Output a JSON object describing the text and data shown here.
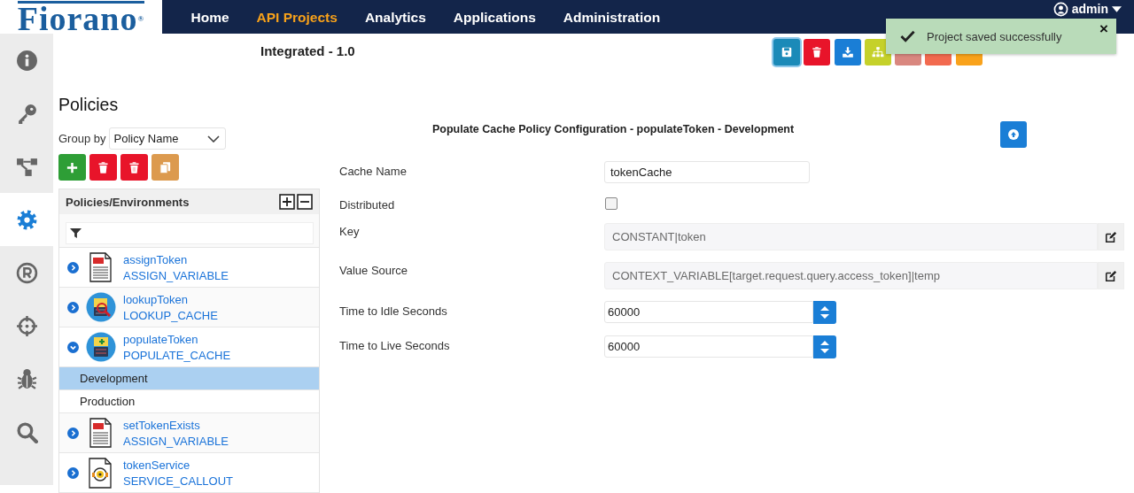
{
  "logo": "Fiorano$^{®}$",
  "nav": [
    {
      "label": "Home",
      "selected": false
    },
    {
      "label": "API Projects",
      "selected": true
    },
    {
      "label": "Analytics",
      "selected": false
    },
    {
      "label": "Applications",
      "selected": false
    },
    {
      "label": "Administration",
      "selected": false
    }
  ],
  "user": {
    "name": "admin"
  },
  "sidebar": {
    "items": [
      {
        "kind": "info",
        "selected": false
      },
      {
        "kind": "key",
        "selected": false
      },
      {
        "kind": "flow",
        "selected": false
      },
      {
        "kind": "gear",
        "selected": true
      },
      {
        "kind": "registered",
        "selected": false
      },
      {
        "kind": "target",
        "selected": false
      },
      {
        "kind": "bug",
        "selected": false
      },
      {
        "kind": "search",
        "selected": false
      }
    ]
  },
  "project": {
    "title": "Integrated - 1.0"
  },
  "toolbar": [
    {
      "kind": "save",
      "focused": true
    },
    {
      "kind": "delete",
      "focused": false
    },
    {
      "kind": "download",
      "focused": false
    },
    {
      "kind": "sitemap",
      "focused": false
    },
    {
      "kind": "muted",
      "focused": false
    },
    {
      "kind": "alert",
      "focused": false
    },
    {
      "kind": "warn",
      "focused": false
    }
  ],
  "toast": {
    "message": "Project saved successfully",
    "close": "×"
  },
  "policies": {
    "heading": "Policies",
    "group_by": {
      "label": "Group by",
      "value": "Policy Name"
    },
    "actions": [
      {
        "kind": "add"
      },
      {
        "kind": "delete"
      },
      {
        "kind": "purge"
      },
      {
        "kind": "copy"
      }
    ],
    "tree": {
      "header": "Policies/Environments",
      "items": [
        {
          "name": "assignToken",
          "type": "ASSIGN_VARIABLE",
          "kind": "variable",
          "expanded": false
        },
        {
          "name": "lookupToken",
          "type": "LOOKUP_CACHE",
          "kind": "lookup",
          "expanded": false
        },
        {
          "name": "populateToken",
          "type": "POPULATE_CACHE",
          "kind": "populate",
          "expanded": true,
          "children": [
            {
              "name": "Development",
              "selected": true
            },
            {
              "name": "Production",
              "selected": false
            }
          ]
        },
        {
          "name": "setTokenExists",
          "type": "ASSIGN_VARIABLE",
          "kind": "variable",
          "expanded": false
        },
        {
          "name": "tokenService",
          "type": "SERVICE_CALLOUT",
          "kind": "service",
          "expanded": false
        }
      ]
    }
  },
  "form": {
    "title": "Populate Cache Policy Configuration - populateToken - Development",
    "fields": [
      {
        "kind": "text",
        "label": "Cache Name",
        "value": "tokenCache"
      },
      {
        "kind": "checkbox",
        "label": "Distributed",
        "checked": false
      },
      {
        "kind": "readonly",
        "label": "Key",
        "value": "CONSTANT|token"
      },
      {
        "kind": "readonly",
        "label": "Value Source",
        "value": "CONTEXT_VARIABLE[target.request.query.access_token]|temp"
      },
      {
        "kind": "number",
        "label": "Time to Idle Seconds",
        "value": "60000"
      },
      {
        "kind": "number",
        "label": "Time to Live Seconds",
        "value": "60000"
      }
    ]
  }
}
